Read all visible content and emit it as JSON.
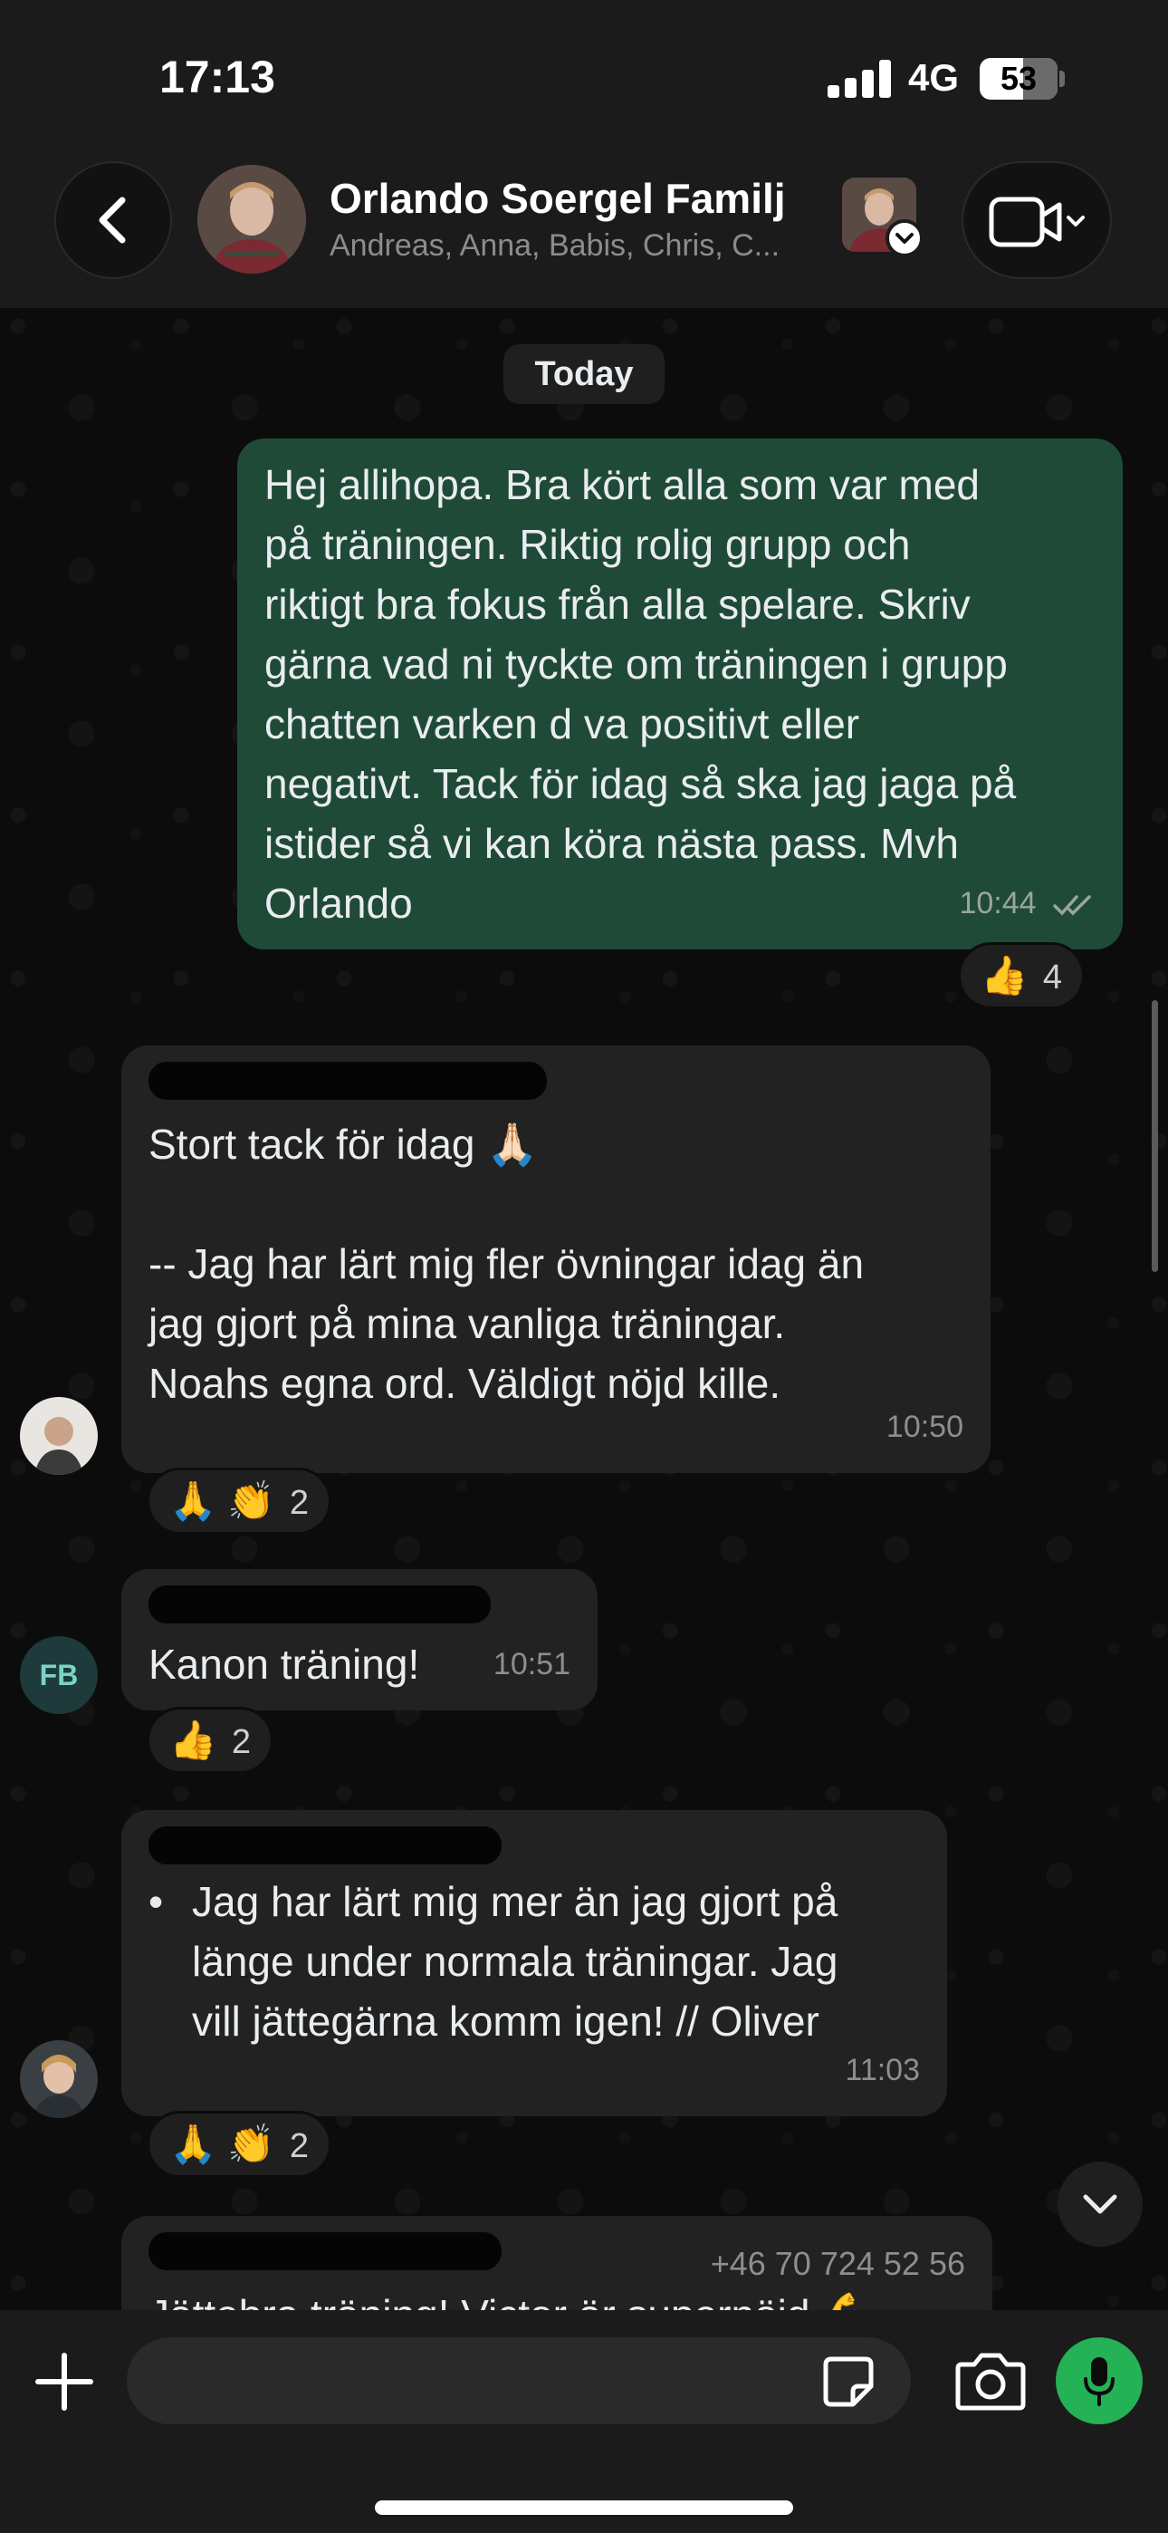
{
  "status_bar": {
    "time": "17:13",
    "network": "4G",
    "battery": "53"
  },
  "header": {
    "title": "Orlando Soergel Familj",
    "subtitle": "Andreas, Anna, Babis, Chris, C..."
  },
  "date_separator": "Today",
  "messages": [
    {
      "direction": "outgoing",
      "text": "Hej allihopa. Bra kört alla som var med\npå träningen. Riktig rolig grupp och\nriktigt bra fokus från alla spelare. Skriv\ngärna vad ni tyckte om träningen i grupp\nchatten varken d va positivt eller\nnegativt. Tack för idag så ska jag jaga på\nistider så vi kan köra nästa pass. Mvh\nOrlando",
      "time": "10:44",
      "reactions": {
        "emoji": "👍",
        "count": "4"
      }
    },
    {
      "direction": "incoming",
      "text": "Stort tack för idag 🙏🏻\n\n-- Jag har lärt mig fler övningar idag än\njag gjort på mina vanliga träningar.\nNoahs egna ord. Väldigt nöjd kille.",
      "time": "10:50",
      "reactions": {
        "emoji": "🙏 👏",
        "count": "2"
      }
    },
    {
      "direction": "incoming",
      "text": "Kanon träning!",
      "time": "10:51",
      "avatar_initials": "FB",
      "reactions": {
        "emoji": "👍",
        "count": "2"
      }
    },
    {
      "direction": "incoming",
      "bullet": "•",
      "text": "Jag har lärt mig mer än jag gjort på\nlänge under normala träningar. Jag\nvill jättegärna komm igen! // Oliver",
      "time": "11:03",
      "reactions": {
        "emoji": "🙏 👏",
        "count": "2"
      }
    },
    {
      "direction": "incoming",
      "phone": "+46 70 724 52 56",
      "text": "Jättebra träning! Victor är supernöjd 💪"
    }
  ],
  "colors": {
    "outgoing_bubble": "#1f4a38",
    "incoming_bubble": "#222222",
    "mic_button": "#25b156"
  },
  "icons": {
    "back": "chevron-left-icon",
    "video": "video-camera-icon",
    "plus": "plus-icon",
    "sticker": "sticker-icon",
    "camera": "camera-icon",
    "mic": "microphone-icon",
    "scroll": "chevron-down-icon"
  }
}
